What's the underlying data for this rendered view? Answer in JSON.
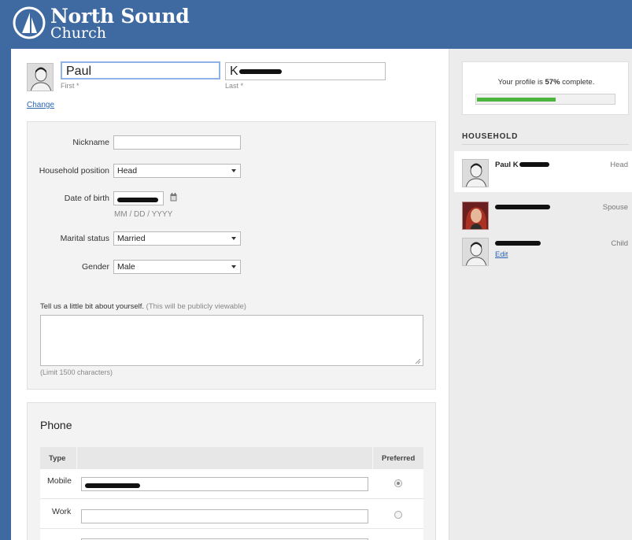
{
  "brand": {
    "line1": "North Sound",
    "line2": "Church",
    "color": "#3f6aa1"
  },
  "profile": {
    "change_label": "Change",
    "first_name": "Paul",
    "last_name": "K",
    "first_label": "First *",
    "last_label": "Last *"
  },
  "details": {
    "nickname": {
      "label": "Nickname",
      "value": ""
    },
    "household_position": {
      "label": "Household position",
      "value": "Head"
    },
    "dob": {
      "label": "Date of birth",
      "hint": "MM / DD / YYYY"
    },
    "marital": {
      "label": "Marital status",
      "value": "Married"
    },
    "gender": {
      "label": "Gender",
      "value": "Male"
    },
    "about": {
      "label": "Tell us a little bit about yourself.",
      "note": "(This will be publicly viewable)",
      "limit": "(Limit 1500 characters)",
      "value": ""
    }
  },
  "phone": {
    "title": "Phone",
    "headers": {
      "type": "Type",
      "preferred": "Preferred"
    },
    "rows": [
      {
        "type": "Mobile",
        "value": "",
        "preferred": true
      },
      {
        "type": "Work",
        "value": "",
        "preferred": false
      }
    ]
  },
  "sidebar": {
    "progress_prefix": "Your profile is ",
    "progress_value": "57%",
    "progress_suffix": " complete.",
    "progress_fraction": 0.57,
    "household_title": "HOUSEHOLD",
    "members": [
      {
        "name": "Paul K",
        "role": "Head",
        "edit": ""
      },
      {
        "name": "",
        "role": "Spouse",
        "edit": ""
      },
      {
        "name": "",
        "role": "Child",
        "edit": "Edit"
      }
    ]
  },
  "colors": {
    "accent": "#3f6aa1",
    "link": "#2a63b4",
    "progress": "#4cb53d"
  }
}
